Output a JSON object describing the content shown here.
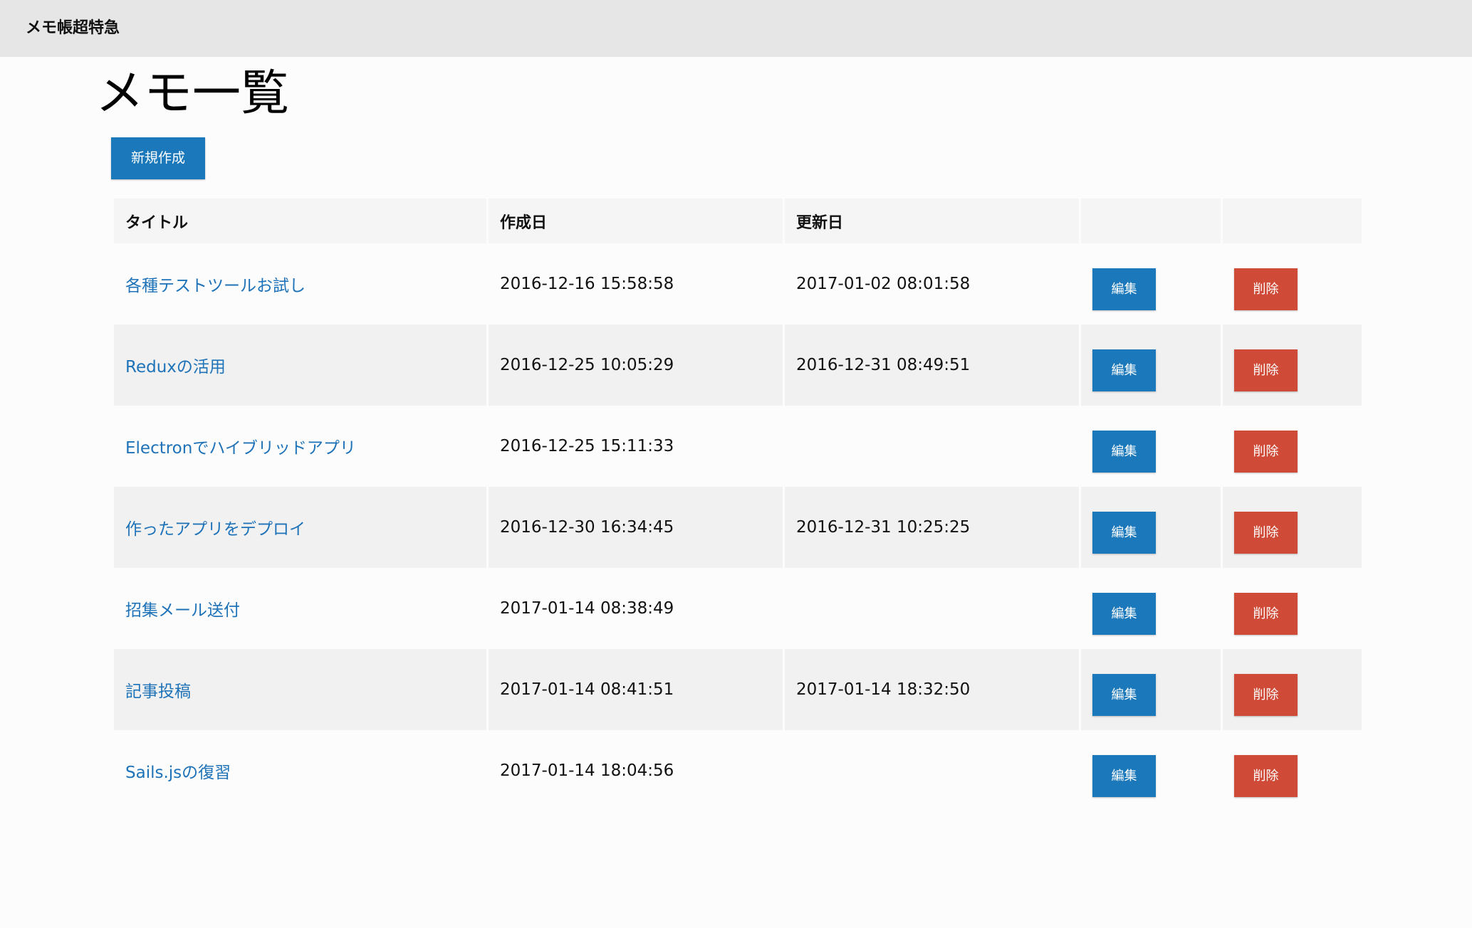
{
  "header": {
    "brand": "メモ帳超特急"
  },
  "page": {
    "title": "メモ一覧",
    "new_button_label": "新規作成"
  },
  "table": {
    "columns": [
      "タイトル",
      "作成日",
      "更新日",
      "",
      ""
    ],
    "rows": [
      {
        "title": "各種テストツールお試し",
        "created": "2016-12-16 15:58:58",
        "updated": "2017-01-02 08:01:58",
        "edit": "編集",
        "delete": "削除"
      },
      {
        "title": "Reduxの活用",
        "created": "2016-12-25 10:05:29",
        "updated": "2016-12-31 08:49:51",
        "edit": "編集",
        "delete": "削除"
      },
      {
        "title": "Electronでハイブリッドアプリ",
        "created": "2016-12-25 15:11:33",
        "updated": "",
        "edit": "編集",
        "delete": "削除"
      },
      {
        "title": "作ったアプリをデプロイ",
        "created": "2016-12-30 16:34:45",
        "updated": "2016-12-31 10:25:25",
        "edit": "編集",
        "delete": "削除"
      },
      {
        "title": "招集メール送付",
        "created": "2017-01-14 08:38:49",
        "updated": "",
        "edit": "編集",
        "delete": "削除"
      },
      {
        "title": "記事投稿",
        "created": "2017-01-14 08:41:51",
        "updated": "2017-01-14 18:32:50",
        "edit": "編集",
        "delete": "削除"
      },
      {
        "title": "Sails.jsの復習",
        "created": "2017-01-14 18:04:56",
        "updated": "",
        "edit": "編集",
        "delete": "削除"
      }
    ]
  },
  "colors": {
    "primary": "#1a78bb",
    "danger": "#cf4b37",
    "link": "#1e72b8",
    "topbar": "#e6e6e6"
  }
}
